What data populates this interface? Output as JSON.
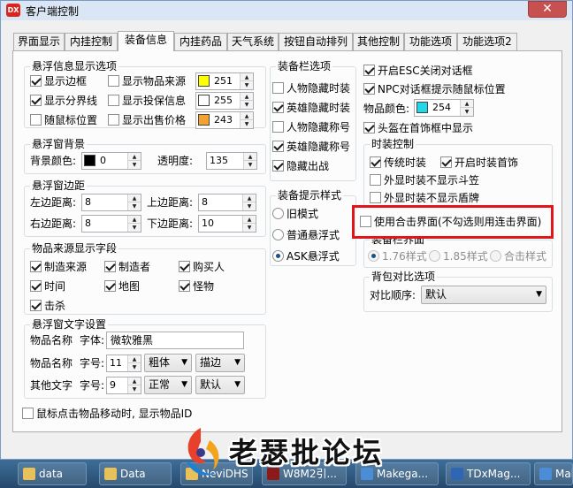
{
  "window": {
    "title": "客户端控制",
    "close_glyph": "✕",
    "icon_text": "DX"
  },
  "tabs": [
    "界面显示",
    "内挂控制",
    "装备信息",
    "内挂药品",
    "天气系统",
    "按钮自动排列",
    "其他控制",
    "功能选项",
    "功能选项2"
  ],
  "float_info": {
    "title": "悬浮信息显示选项",
    "show_border": "显示边框",
    "show_divider": "显示分界线",
    "follow_mouse": "随鼠标位置",
    "show_source": "显示物品来源",
    "show_investor": "显示投保信息",
    "show_sell_price": "显示出售价格",
    "source_color": "251",
    "investor_color": "255",
    "sell_color": "243",
    "source_hex": "#ffff00",
    "investor_hex": "#ffffff",
    "sell_hex": "#f4a330"
  },
  "float_bg": {
    "title": "悬浮窗背景",
    "bg_label": "背景颜色:",
    "bg_value": "0",
    "bg_hex": "#000000",
    "alpha_label": "透明度:",
    "alpha_value": "135"
  },
  "margins": {
    "title": "悬浮窗边距",
    "left_label": "左边距离:",
    "left": "8",
    "top_label": "上边距离:",
    "top": "8",
    "right_label": "右边距离:",
    "right": "8",
    "bottom_label": "下边距离:",
    "bottom": "10"
  },
  "source_fields": {
    "title": "物品来源显示字段",
    "maker_source": "制造来源",
    "maker": "制造者",
    "buyer": "购买人",
    "time": "时间",
    "map": "地图",
    "monster": "怪物",
    "kill": "击杀"
  },
  "text_settings": {
    "title": "悬浮窗文字设置",
    "item_name": "物品名称",
    "font_label": "字体:",
    "font_value": "微软雅黑",
    "size_label": "字号:",
    "item_size": "11",
    "item_weight": "粗体",
    "item_style": "描边",
    "other_text": "其他文字",
    "other_size": "9",
    "other_weight": "正常",
    "other_style": "默认"
  },
  "mouse_show_id": "鼠标点击物品移动时, 显示物品ID",
  "equip_bar": {
    "title": "装备栏选项",
    "hide_char_fashion": "人物隐藏时装",
    "hide_hero_fashion": "英雄隐藏时装",
    "hide_char_title": "人物隐藏称号",
    "hide_hero_title": "英雄隐藏称号",
    "hide_battle": "隐藏出战"
  },
  "equip_tip": {
    "title": "装备提示样式",
    "old": "旧模式",
    "normal": "普通悬浮式",
    "ask": "ASK悬浮式"
  },
  "right": {
    "esc_close": "开启ESC关闭对话框",
    "npc_tip": "NPC对话框提示随鼠标位置",
    "item_color_label": "物品颜色:",
    "item_color": "254",
    "item_color_hex": "#22d8e8",
    "helmet_show": "头盔在首饰框中显示"
  },
  "fashion": {
    "title": "时装控制",
    "traditional": "传统时装",
    "fashion_jewelry": "开启时装首饰",
    "hide_hat": "外显时装不显示斗笠",
    "hide_shield": "外显时装不显示盾牌"
  },
  "combined": "使用合击界面(不勾选则用连击界面)",
  "equip_ui": {
    "title": "装备栏界面",
    "v176": "1.76样式",
    "v185": "1.85样式",
    "combined": "合击样式"
  },
  "bag_compare": {
    "title": "背包对比选项",
    "order_label": "对比顺序:",
    "order_value": "默认"
  },
  "taskbar": [
    "data",
    "Data",
    "NeviDHS",
    "W8M2引...",
    "Makega...",
    "TDxMag...",
    "Make"
  ],
  "watermark_text": "老瑟批论坛"
}
